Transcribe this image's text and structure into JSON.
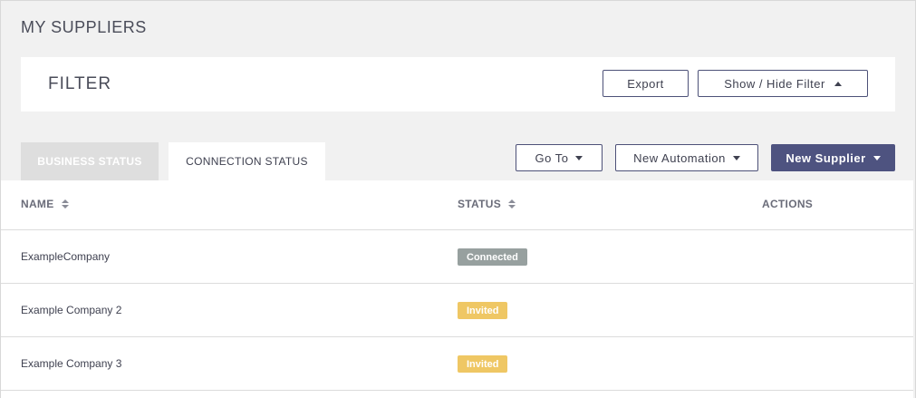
{
  "page": {
    "title": "MY SUPPLIERS"
  },
  "filter": {
    "title": "FILTER",
    "export_label": "Export",
    "show_hide_label": "Show / Hide Filter"
  },
  "tabs": [
    {
      "label": "BUSINESS STATUS",
      "active": false
    },
    {
      "label": "CONNECTION STATUS",
      "active": true
    }
  ],
  "toolbar": {
    "goto_label": "Go To",
    "new_automation_label": "New Automation",
    "new_supplier_label": "New Supplier"
  },
  "table": {
    "columns": [
      "NAME",
      "STATUS",
      "ACTIONS"
    ],
    "rows": [
      {
        "name": "ExampleCompany",
        "status": "Connected",
        "status_color": "#97a09f"
      },
      {
        "name": "Example Company 2",
        "status": "Invited",
        "status_color": "#efc764"
      },
      {
        "name": "Example Company 3",
        "status": "Invited",
        "status_color": "#efc764"
      }
    ]
  },
  "colors": {
    "primary": "#4e5380",
    "connected": "#97a09f",
    "invited": "#efc764"
  }
}
